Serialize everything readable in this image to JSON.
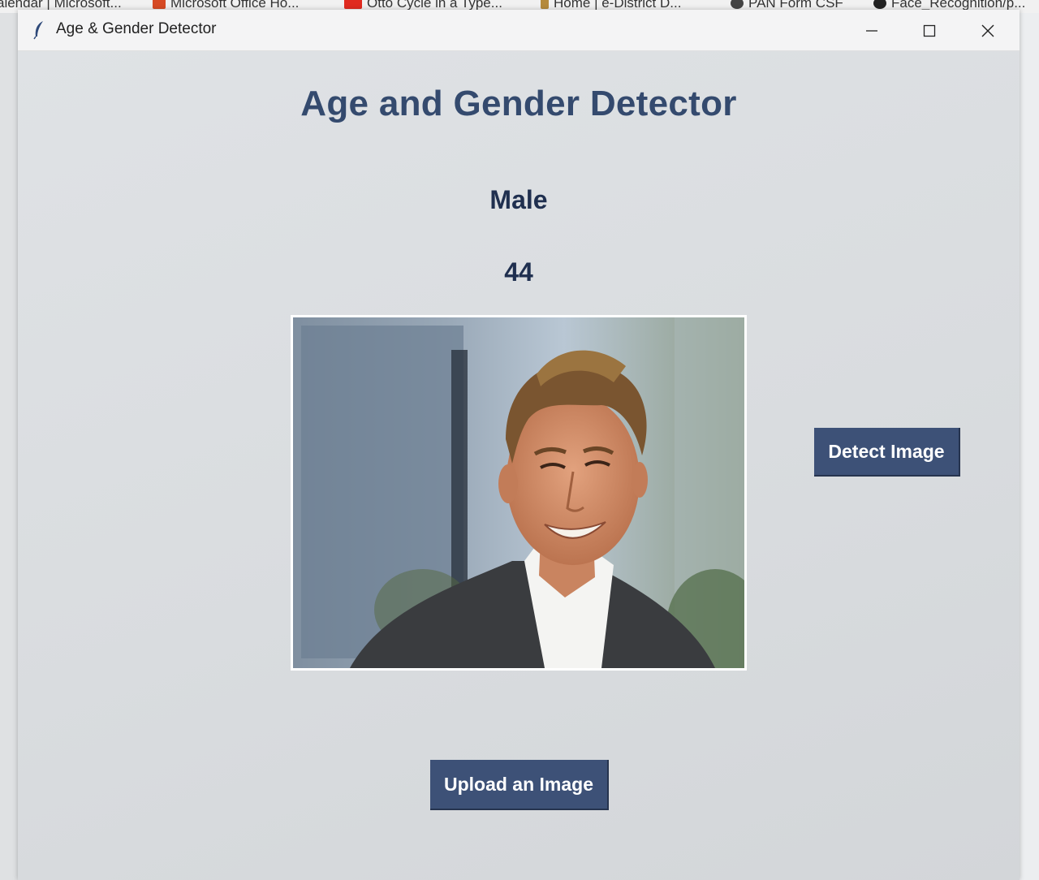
{
  "browser_bookmarks": [
    {
      "label": "alendar | Microsoft...",
      "icon": "none"
    },
    {
      "label": "Microsoft Office Ho...",
      "icon": "office-icon"
    },
    {
      "label": "Otto Cycle in a Type...",
      "icon": "youtube-icon"
    },
    {
      "label": "Home | e-District D...",
      "icon": "emblem-icon"
    },
    {
      "label": "PAN Form CSF",
      "icon": "link-icon"
    },
    {
      "label": "Face_Recognition/p...",
      "icon": "github-icon"
    }
  ],
  "window": {
    "title": "Age & Gender Detector",
    "icon": "feather-icon",
    "controls": [
      "minimize-icon",
      "maximize-icon",
      "close-icon"
    ]
  },
  "app": {
    "heading": "Age and Gender Detector",
    "gender_result": "Male",
    "age_result": "44",
    "image_alt": "uploaded face photo",
    "detect_button_label": "Detect Image",
    "upload_button_label": "Upload an Image"
  },
  "colors": {
    "button_bg": "#3d5177",
    "heading": "#344a6e",
    "result_text": "#1f2f4f",
    "background": "#dcdfe2"
  }
}
